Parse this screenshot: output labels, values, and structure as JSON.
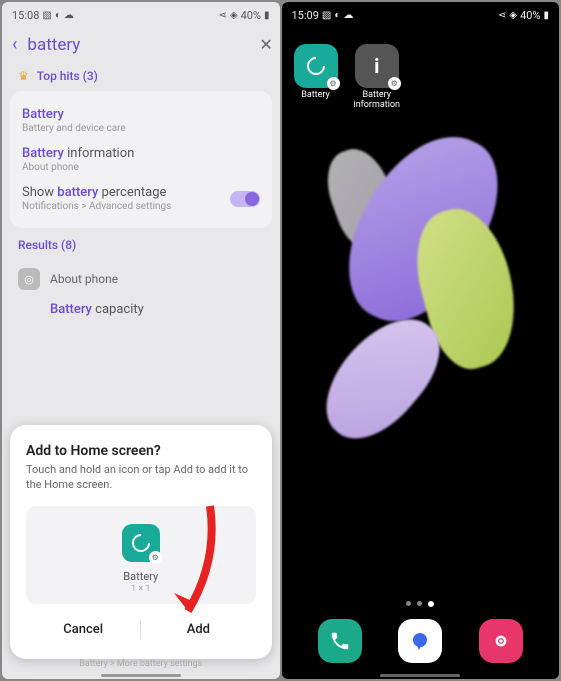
{
  "left": {
    "status": {
      "time": "15:08",
      "battery": "40%"
    },
    "search": {
      "value": "battery"
    },
    "topHits": {
      "header": "Top hits (3)",
      "items": [
        {
          "title_hl": "Battery",
          "sub": "Battery and device care"
        },
        {
          "title_hl": "Battery",
          "title_rest": " information",
          "sub": "About phone"
        },
        {
          "title_pre": "Show ",
          "title_hl": "battery",
          "title_rest": " percentage",
          "sub": "Notifications > Advanced settings"
        }
      ]
    },
    "results": {
      "header": "Results (8)",
      "group": "About phone",
      "item_hl": "Battery",
      "item_rest": " capacity"
    },
    "modal": {
      "title": "Add to Home screen?",
      "text": "Touch and hold an icon or tap Add to add it to the Home screen.",
      "appName": "Battery",
      "appSize": "1 × 1",
      "cancel": "Cancel",
      "add": "Add"
    },
    "faded": "Battery > More battery settings"
  },
  "right": {
    "status": {
      "time": "15:09",
      "battery": "40%"
    },
    "apps": [
      {
        "label": "Battery",
        "color": "#1aaa9a"
      },
      {
        "label": "Battery\ninformation",
        "color": "#555"
      }
    ]
  }
}
